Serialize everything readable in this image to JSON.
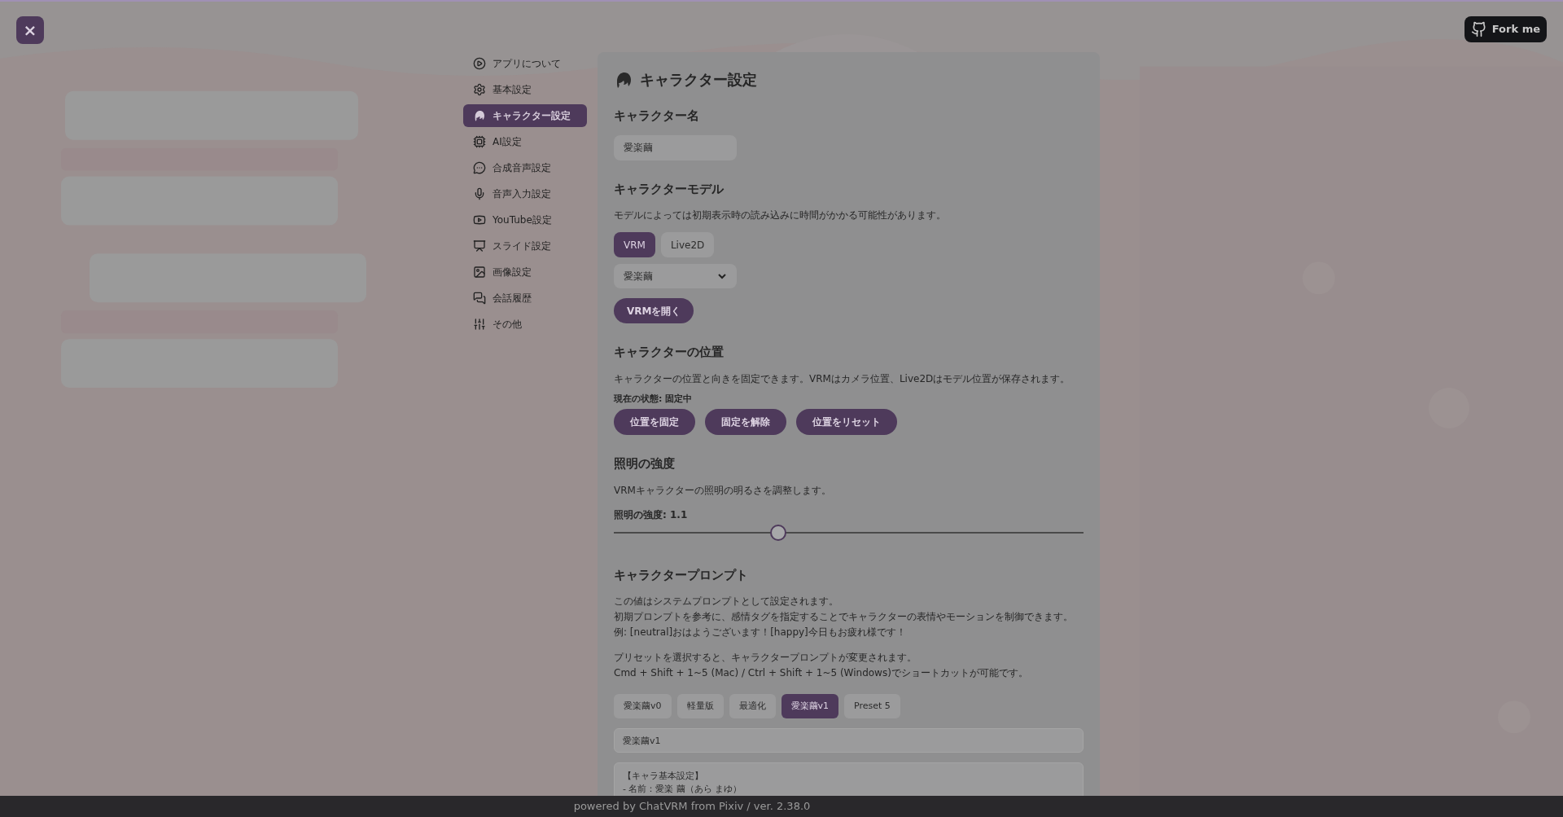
{
  "close_button": {
    "label": "×"
  },
  "fork_button": {
    "label": "Fork me"
  },
  "sidebar": {
    "items": [
      {
        "label": "アプリについて",
        "selected": false
      },
      {
        "label": "基本設定",
        "selected": false
      },
      {
        "label": "キャラクター設定",
        "selected": true
      },
      {
        "label": "AI設定",
        "selected": false
      },
      {
        "label": "合成音声設定",
        "selected": false
      },
      {
        "label": "音声入力設定",
        "selected": false
      },
      {
        "label": "YouTube設定",
        "selected": false
      },
      {
        "label": "スライド設定",
        "selected": false
      },
      {
        "label": "画像設定",
        "selected": false
      },
      {
        "label": "会話履歴",
        "selected": false
      },
      {
        "label": "その他",
        "selected": false
      }
    ]
  },
  "panel": {
    "title": "キャラクター設定",
    "name_section": {
      "heading": "キャラクター名",
      "value": "愛楽繭"
    },
    "model_section": {
      "heading": "キャラクターモデル",
      "description": "モデルによっては初期表示時の読み込みに時間がかかる可能性があります。",
      "model_types": [
        {
          "label": "VRM",
          "selected": true
        },
        {
          "label": "Live2D",
          "selected": false
        }
      ],
      "model_select": "愛楽繭",
      "open_button": "VRMを開く"
    },
    "position_section": {
      "heading": "キャラクターの位置",
      "description": "キャラクターの位置と向きを固定できます。VRMはカメラ位置、Live2Dはモデル位置が保存されます。",
      "status": "現在の状態: 固定中",
      "buttons": [
        "位置を固定",
        "固定を解除",
        "位置をリセット"
      ]
    },
    "lighting_section": {
      "heading": "照明の強度",
      "description": "VRMキャラクターの照明の明るさを調整します。",
      "slider_label": "照明の強度: 1.1",
      "level": 0.35
    },
    "prompt_section": {
      "heading": "キャラクタープロンプト",
      "description_lines": [
        "この値はシステムプロンプトとして設定されます。",
        "初期プロンプトを参考に、感情タグを指定することでキャラクターの表情やモーションを制御できます。例: [neutral]おはようございます！[happy]今日もお疲れ様です！"
      ],
      "preset_lines": [
        "プリセットを選択すると、キャラクタープロンプトが変更されます。",
        "Cmd + Shift + 1~5 (Mac) / Ctrl + Shift + 1~5 (Windows)でショートカットが可能です。"
      ],
      "presets": [
        {
          "label": "愛楽繭v0",
          "selected": false
        },
        {
          "label": "軽量版",
          "selected": false
        },
        {
          "label": "最適化",
          "selected": false
        },
        {
          "label": "愛楽繭v1",
          "selected": true
        },
        {
          "label": "Preset 5",
          "selected": false
        }
      ],
      "preset_name": "愛楽繭v1",
      "prompt_lines": [
        "【キャラ基本設定】",
        "- 名前：愛楽 繭（あら まゆ）"
      ]
    }
  },
  "footer": {
    "text": "powered by ChatVRM from Pixiv / ver. 2.38.0"
  }
}
